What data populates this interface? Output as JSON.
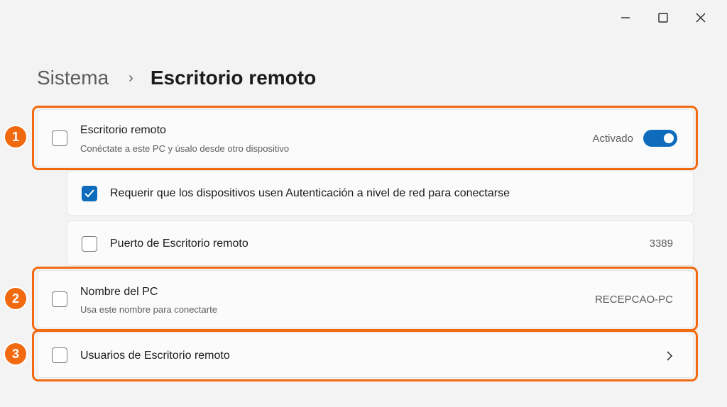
{
  "window": {
    "minimize_icon": "minimize-icon",
    "maximize_icon": "maximize-icon",
    "close_icon": "close-icon"
  },
  "breadcrumb": {
    "parent": "Sistema",
    "separator": "›",
    "current": "Escritorio remoto"
  },
  "settings": {
    "remote_desktop": {
      "title": "Escritorio remoto",
      "subtitle": "Conéctate a este PC y úsalo desde otro dispositivo",
      "status": "Activado",
      "enabled": true
    },
    "nla": {
      "label": "Requerir que los dispositivos usen Autenticación a nivel de red para conectarse",
      "checked": true
    },
    "port": {
      "label": "Puerto de Escritorio remoto",
      "value": "3389"
    },
    "pc_name": {
      "title": "Nombre del PC",
      "subtitle": "Usa este nombre para conectarte",
      "value": "RECEPCAO-PC"
    },
    "users": {
      "title": "Usuarios de Escritorio remoto"
    }
  },
  "annotations": {
    "color": "#f26a10",
    "badges": [
      "1",
      "2",
      "3"
    ]
  },
  "colors": {
    "accent": "#0f6cbd",
    "background": "#f3f3f3",
    "card": "#fbfbfb"
  }
}
